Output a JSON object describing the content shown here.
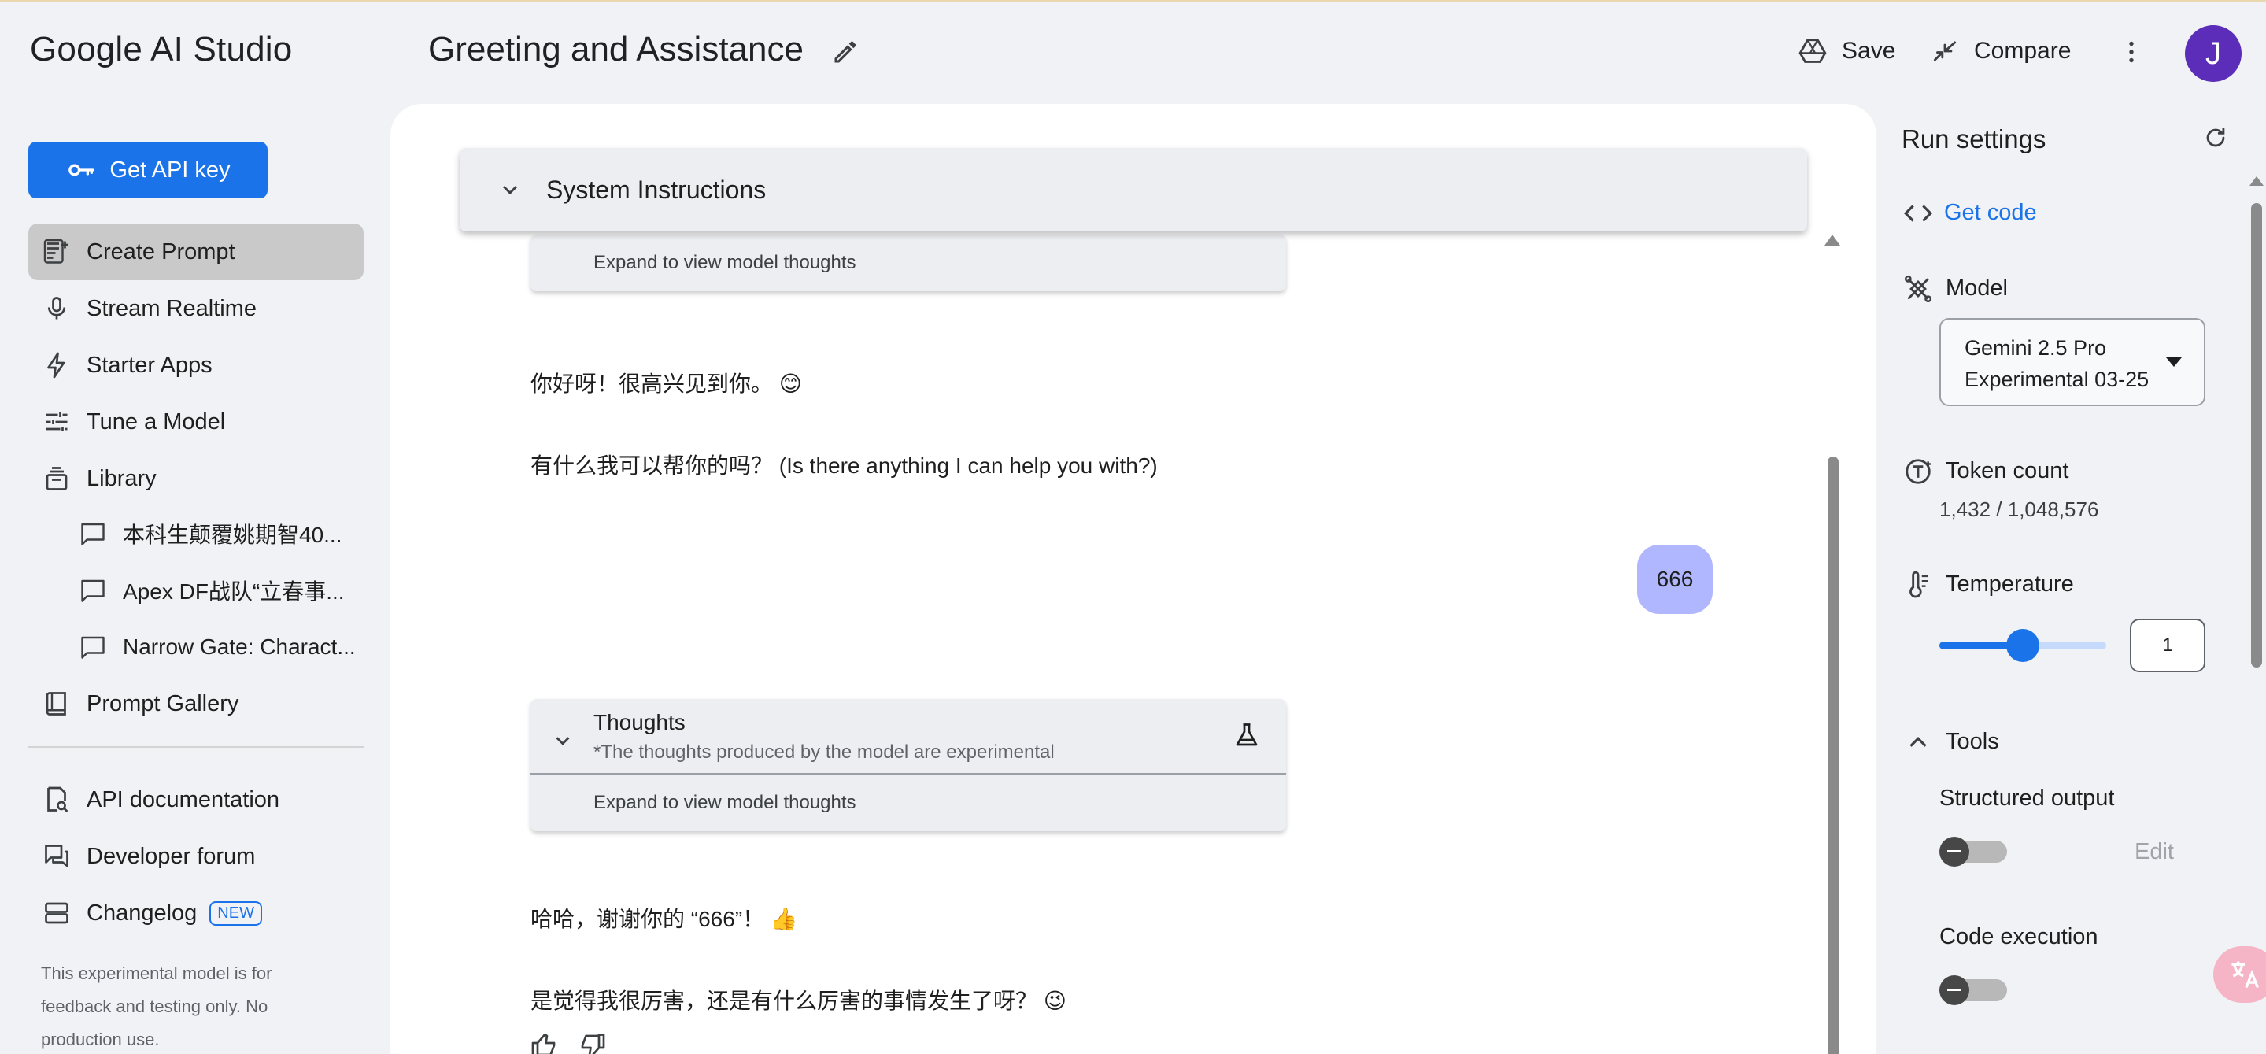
{
  "header": {
    "app_title": "Google AI Studio",
    "prompt_title": "Greeting and Assistance",
    "save_label": "Save",
    "compare_label": "Compare",
    "avatar_initial": "J"
  },
  "sidebar": {
    "api_key_label": "Get API key",
    "items": [
      {
        "label": "Create Prompt",
        "icon": "create-prompt-icon",
        "active": true
      },
      {
        "label": "Stream Realtime",
        "icon": "microphone-icon"
      },
      {
        "label": "Starter Apps",
        "icon": "lightning-icon"
      },
      {
        "label": "Tune a Model",
        "icon": "sliders-icon"
      },
      {
        "label": "Library",
        "icon": "library-icon"
      }
    ],
    "library_items": [
      "本科生颠覆姚期智40...",
      "Apex DF战队“立春事...",
      "Narrow Gate: Charact..."
    ],
    "gallery_label": "Prompt Gallery",
    "bottom_items": [
      {
        "label": "API documentation",
        "icon": "api-doc-icon"
      },
      {
        "label": "Developer forum",
        "icon": "forum-icon"
      },
      {
        "label": "Changelog",
        "icon": "changelog-icon",
        "badge": "NEW"
      }
    ],
    "disclaimer": "This experimental model is for feedback and testing only. No production use."
  },
  "chat": {
    "system_instructions_label": "System Instructions",
    "expand_thoughts_label": "Expand to view model thoughts",
    "thoughts_title": "Thoughts",
    "thoughts_subtitle": "*The thoughts produced by the model are experimental",
    "messages": [
      {
        "role": "model",
        "text": "你好呀！很高兴见到你。 😊"
      },
      {
        "role": "model",
        "text": "有什么我可以帮你的吗？ (Is there anything I can help you with?)"
      },
      {
        "role": "user",
        "text": "666"
      },
      {
        "role": "model",
        "text": "哈哈，谢谢你的 “666”！ 👍"
      },
      {
        "role": "model",
        "text": "是觉得我很厉害，还是有什么厉害的事情发生了呀？ 😉"
      }
    ]
  },
  "run_settings": {
    "title": "Run settings",
    "get_code_label": "Get code",
    "model_label": "Model",
    "model_value_line1": "Gemini 2.5 Pro",
    "model_value_line2": "Experimental 03-25",
    "token_count_label": "Token count",
    "token_count_value": "1,432 / 1,048,576",
    "temperature_label": "Temperature",
    "temperature_value": "1",
    "temperature_fraction": 0.5,
    "tools_label": "Tools",
    "structured_output_label": "Structured output",
    "structured_output_on": false,
    "edit_label": "Edit",
    "code_execution_label": "Code execution",
    "code_execution_on": false
  },
  "colors": {
    "accent": "#1a73e8",
    "user_bubble": "#b0b7ff",
    "avatar": "#5b2db8",
    "background": "#f0f2f5"
  }
}
